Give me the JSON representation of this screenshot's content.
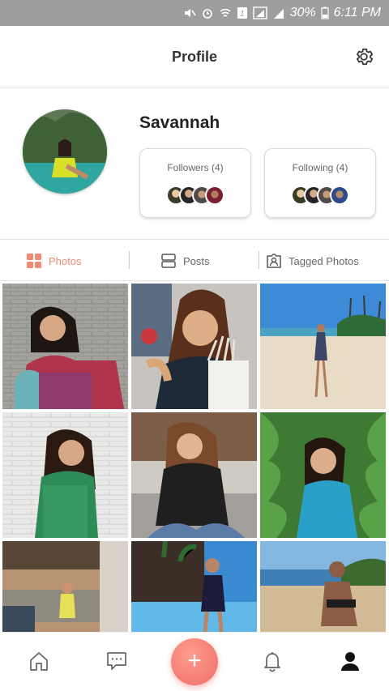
{
  "status_bar": {
    "battery_percent": "30%",
    "time": "6:11 PM"
  },
  "header": {
    "title": "Profile"
  },
  "profile": {
    "name": "Savannah",
    "followers_label": "Followers (4)",
    "following_label": "Following (4)"
  },
  "tabs": [
    {
      "label": "Photos",
      "active": true
    },
    {
      "label": "Posts",
      "active": false
    },
    {
      "label": "Tagged Photos",
      "active": false
    }
  ],
  "accent_color": "#f08a72",
  "fab_color": "#ee6f6a",
  "bottom_nav": [
    "home-icon",
    "chat-icon",
    "add-icon",
    "bell-icon",
    "user-icon"
  ],
  "fab_label": "+"
}
